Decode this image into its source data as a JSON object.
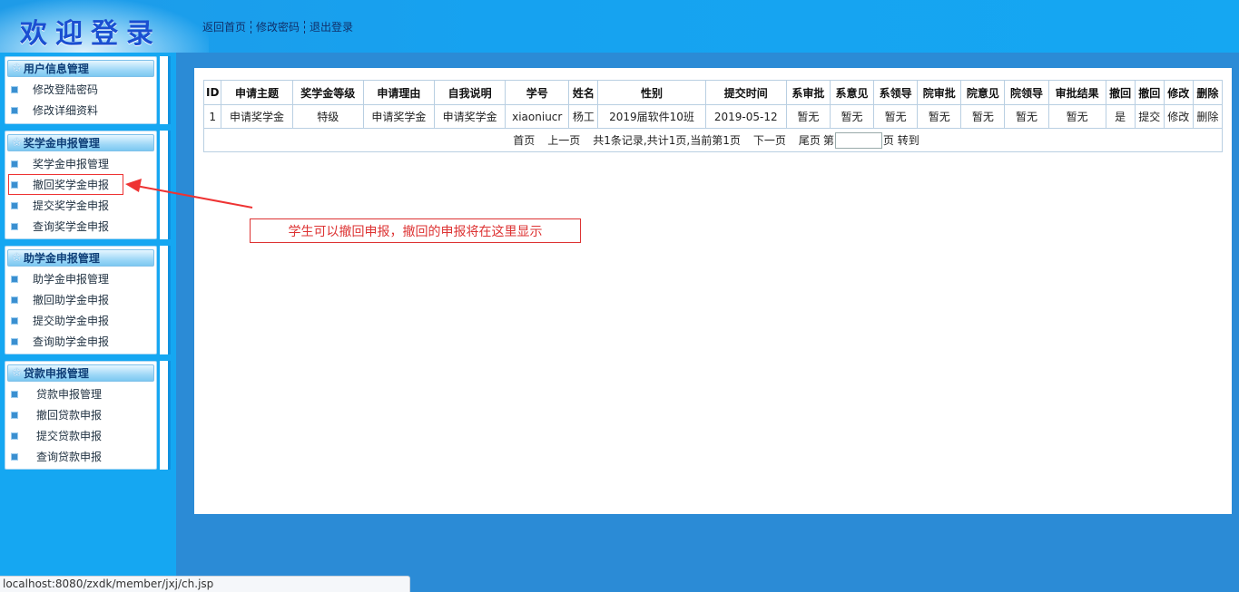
{
  "header": {
    "title": "欢迎登录",
    "nav": [
      "返回首页",
      "修改密码",
      "退出登录"
    ]
  },
  "sidebar": {
    "groups": [
      {
        "title": "用户信息管理",
        "items": [
          "修改登陆密码",
          "修改详细资料"
        ]
      },
      {
        "title": "奖学金申报管理",
        "items": [
          "奖学金申报管理",
          "撤回奖学金申报",
          "提交奖学金申报",
          "查询奖学金申报"
        ]
      },
      {
        "title": "助学金申报管理",
        "items": [
          "助学金申报管理",
          "撤回助学金申报",
          "提交助学金申报",
          "查询助学金申报"
        ]
      },
      {
        "title": "贷款申报管理",
        "items": [
          "贷款申报管理",
          "撤回贷款申报",
          "提交贷款申报",
          "查询贷款申报"
        ]
      }
    ]
  },
  "table": {
    "headers": [
      "ID",
      "申请主题",
      "奖学金等级",
      "申请理由",
      "自我说明",
      "学号",
      "姓名",
      "性别",
      "提交时间",
      "系审批",
      "系意见",
      "系领导",
      "院审批",
      "院意见",
      "院领导",
      "审批结果",
      "撤回",
      "撤回",
      "修改",
      "删除"
    ],
    "rows": [
      [
        "1",
        "申请奖学金",
        "特级",
        "申请奖学金",
        "申请奖学金",
        "xiaoniucr",
        "杨工",
        "2019届软件10班",
        "2019-05-12",
        "暂无",
        "暂无",
        "暂无",
        "暂无",
        "暂无",
        "暂无",
        "暂无",
        "是",
        "提交",
        "修改",
        "删除"
      ]
    ]
  },
  "pager": {
    "first": "首页",
    "prev": "上一页",
    "summary": "共1条记录,共计1页,当前第1页",
    "next": "下一页",
    "last": "尾页",
    "page_prefix": "第",
    "page_suffix": "页 转到",
    "page_value": ""
  },
  "annotation": "学生可以撤回申报，撤回的申报将在这里显示",
  "statusbar": "localhost:8080/zxdk/member/jxj/ch.jsp"
}
